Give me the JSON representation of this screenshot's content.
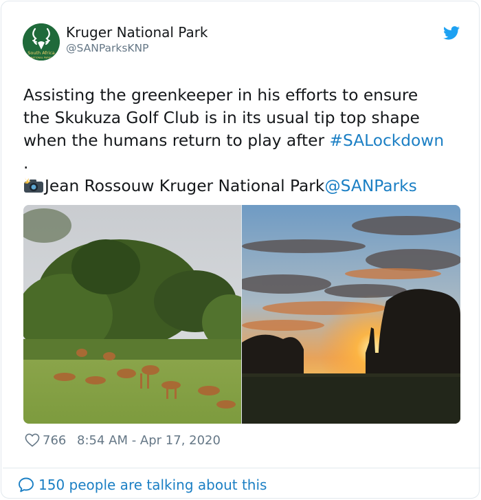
{
  "account": {
    "name": "Kruger National Park",
    "handle": "@SANParksKNP",
    "avatar_text_top": "South Africa",
    "avatar_text_bottom": "NATIONAL PARKS"
  },
  "tweet": {
    "line1": "Assisting the greenkeeper in his efforts to ensure",
    "line2": "the Skukuza Golf Club is in its usual tip top shape",
    "line3_text": "when the humans return to play after ",
    "hashtag": "#SALockdown",
    "dot": ".",
    "credit_name": "Jean Rossouw  Kruger National Park",
    "mention": "@SANParks"
  },
  "media": {
    "photos": [
      {
        "icon": "impala-herd-photo"
      },
      {
        "icon": "sunset-giraffe-photo"
      }
    ]
  },
  "footer": {
    "likes": "766",
    "timestamp": "8:54 AM - Apr 17, 2020",
    "talking": "150 people are talking about this"
  },
  "colors": {
    "link": "#1b7fc4",
    "muted": "#657786",
    "twitter_blue": "#1da1f2",
    "avatar_green": "#1f6a3a"
  }
}
